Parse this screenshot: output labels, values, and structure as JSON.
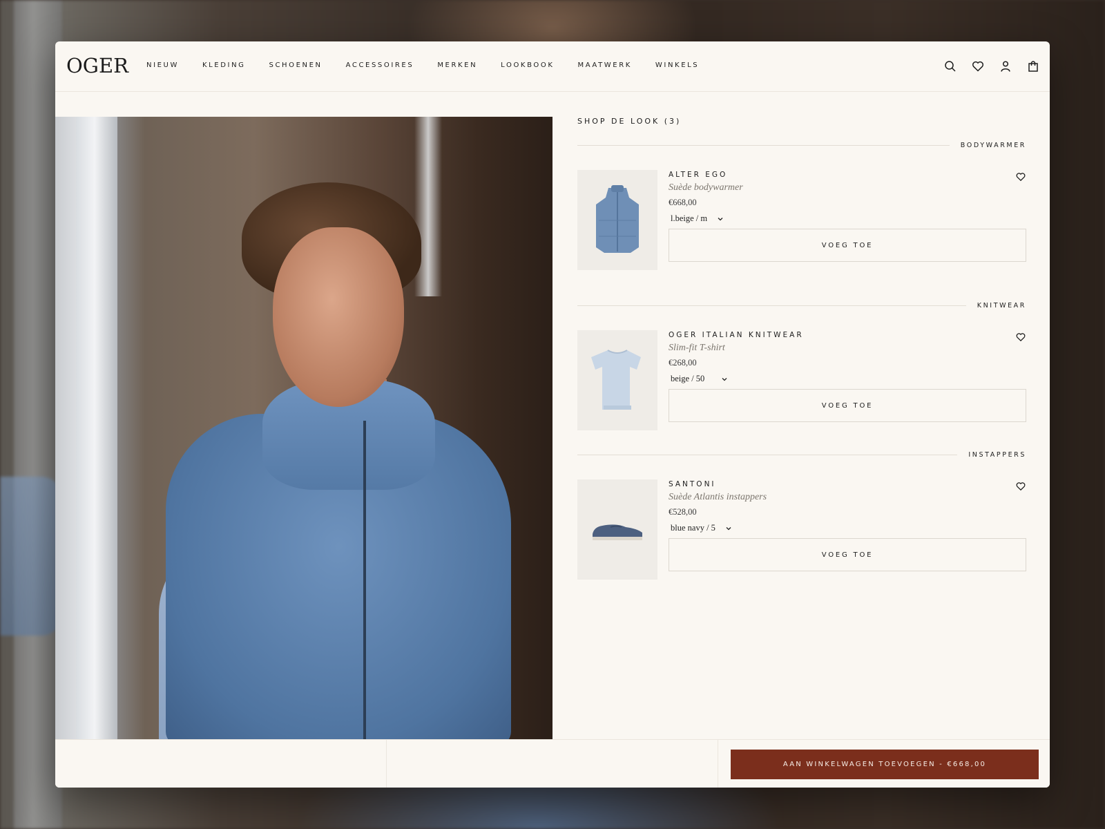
{
  "brand": {
    "logo": "OGER"
  },
  "nav": {
    "items": [
      "NIEUW",
      "KLEDING",
      "SCHOENEN",
      "ACCESSOIRES",
      "MERKEN",
      "LOOKBOOK",
      "MAATWERK",
      "WINKELS"
    ]
  },
  "header_icons": [
    "search-icon",
    "heart-icon",
    "user-icon",
    "bag-icon"
  ],
  "shop_look": {
    "title": "SHOP DE LOOK (3)",
    "sections": [
      {
        "category": "BODYWARMER",
        "brand": "ALTER EGO",
        "name": "Suède bodywarmer",
        "price": "€668,00",
        "variant": "l.beige / m",
        "button": "VOEG TOE"
      },
      {
        "category": "KNITWEAR",
        "brand": "OGER ITALIAN KNITWEAR",
        "name": "Slim-fit T-shirt",
        "price": "€268,00",
        "variant": "beige / 50",
        "button": "VOEG TOE"
      },
      {
        "category": "INSTAPPERS",
        "brand": "SANTONI",
        "name": "Suède Atlantis instappers",
        "price": "€528,00",
        "variant": "blue navy / 5",
        "button": "VOEG TOE"
      }
    ]
  },
  "footer": {
    "cart_button": "AAN WINKELWAGEN TOEVOEGEN - €668,00"
  },
  "colors": {
    "accent": "#7b2e1c",
    "background": "#faf7f2"
  }
}
